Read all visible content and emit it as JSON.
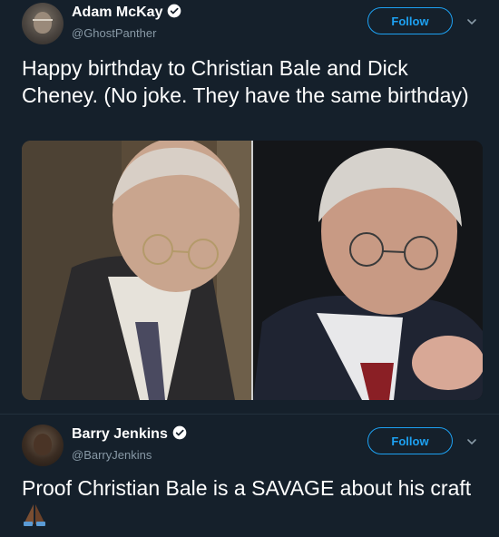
{
  "tweets": [
    {
      "author_name": "Adam McKay",
      "handle": "@GhostPanther",
      "follow_label": "Follow",
      "text": "Happy birthday to Christian Bale and Dick Cheney. (No joke. They have the same birthday)",
      "verified": true
    },
    {
      "author_name": "Barry Jenkins",
      "handle": "@BarryJenkins",
      "follow_label": "Follow",
      "text": "Proof Christian Bale is a SAVAGE about his craft",
      "emoji": "folded-hands-icon",
      "verified": true
    }
  ],
  "colors": {
    "background": "#15202b",
    "accent": "#1da1f2",
    "secondary_text": "#8899a6"
  }
}
